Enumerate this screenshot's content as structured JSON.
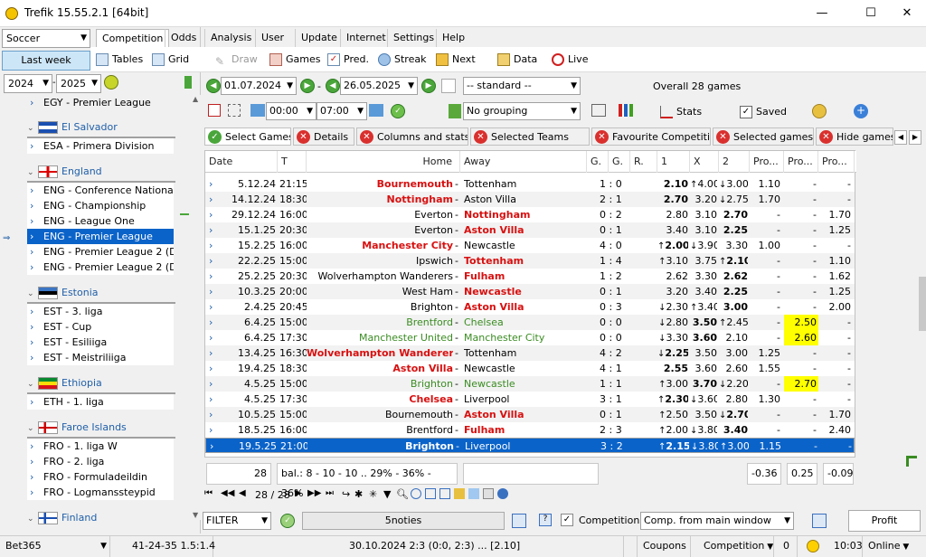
{
  "window": {
    "title": "Trefik 15.55.2.1 [64bit]",
    "minimize": "—",
    "maximize": "☐",
    "close": "✕"
  },
  "sport_select": "Soccer",
  "last_week_button": "Last week",
  "year_from": "2024",
  "year_to": "2025",
  "menu": [
    "Competition",
    "Odds",
    "Analysis",
    "User",
    "Update",
    "Internet",
    "Settings",
    "Help"
  ],
  "toolbar": {
    "tables": "Tables",
    "grid": "Grid",
    "draw": "Draw",
    "games": "Games",
    "pred": "Pred.",
    "streak": "Streak",
    "next": "Next",
    "data": "Data",
    "live": "Live"
  },
  "tree": {
    "top_league": "EGY - Premier League",
    "countries": [
      {
        "name": "El Salvador",
        "leagues": [
          "ESA - Primera Division"
        ]
      },
      {
        "name": "England",
        "leagues": [
          "ENG - Conference National",
          "ENG - Championship",
          "ENG - League One",
          "ENG - Premier League",
          "ENG - Premier League 2 (D...",
          "ENG - Premier League 2 (D..."
        ]
      },
      {
        "name": "Estonia",
        "leagues": [
          "EST - 3. liga",
          "EST - Cup",
          "EST - Esiliiga",
          "EST - Meistriliiga"
        ]
      },
      {
        "name": "Ethiopia",
        "leagues": [
          "ETH - 1. liga"
        ]
      },
      {
        "name": "Faroe Islands",
        "leagues": [
          "FRO - 1. liga W",
          "FRO - 2. liga",
          "FRO - Formuladeildin",
          "FRO - Logmanssteypid"
        ]
      },
      {
        "name": "Finland",
        "leagues": []
      }
    ]
  },
  "filters": {
    "date_from": "01.07.2024",
    "date_to": "26.05.2025",
    "standard": "-- standard --",
    "time_from": "00:00",
    "time_to": "07:00",
    "grouping": "No grouping",
    "overall": "Overall 28 games",
    "stats": "Stats",
    "saved": "Saved"
  },
  "subtabs": [
    "Select Games",
    "Details",
    "Columns and stats",
    "Selected Teams",
    "Favourite Competitions",
    "Selected games",
    "Hide games"
  ],
  "columns": [
    "Date",
    "T",
    "Home",
    "Away",
    "G.",
    "G.",
    "R.",
    "1",
    "X",
    "2",
    "Pro...",
    "Pro...",
    "Pro..."
  ],
  "rows": [
    {
      "date": "5.12.24",
      "time": "21:15",
      "home": "Bournemouth",
      "away": "Tottenham",
      "hs": "red",
      "as": "",
      "g1": "1 : 0",
      "o1": "2.10",
      "a1": "",
      "ox": "4.00",
      "ax": "up",
      "o2": "3.00",
      "a2": "down",
      "b1": "b",
      "bx": "",
      "b2": "",
      "p1": "1.10",
      "p2": "-",
      "p3": "-",
      "y2": false
    },
    {
      "date": "14.12.24",
      "time": "18:30",
      "home": "Nottingham",
      "away": "Aston Villa",
      "hs": "red",
      "as": "",
      "g1": "2 : 1",
      "o1": "2.70",
      "a1": "",
      "ox": "3.20",
      "ax": "",
      "o2": "2.75",
      "a2": "down",
      "b1": "b",
      "bx": "",
      "b2": "",
      "p1": "1.70",
      "p2": "-",
      "p3": "-",
      "y2": false
    },
    {
      "date": "29.12.24",
      "time": "16:00",
      "home": "Everton",
      "away": "Nottingham",
      "hs": "",
      "as": "red",
      "g1": "0 : 2",
      "o1": "2.80",
      "a1": "",
      "ox": "3.10",
      "ax": "",
      "o2": "2.70",
      "a2": "",
      "b1": "",
      "bx": "",
      "b2": "b",
      "p1": "-",
      "p2": "-",
      "p3": "1.70",
      "y2": false
    },
    {
      "date": "15.1.25",
      "time": "20:30",
      "home": "Everton",
      "away": "Aston Villa",
      "hs": "",
      "as": "red",
      "g1": "0 : 1",
      "o1": "3.40",
      "a1": "",
      "ox": "3.10",
      "ax": "",
      "o2": "2.25",
      "a2": "",
      "b1": "",
      "bx": "",
      "b2": "b",
      "p1": "-",
      "p2": "-",
      "p3": "1.25",
      "y2": false
    },
    {
      "date": "15.2.25",
      "time": "16:00",
      "home": "Manchester City",
      "away": "Newcastle",
      "hs": "red",
      "as": "",
      "g1": "4 : 0",
      "o1": "2.00",
      "a1": "up",
      "ox": "3.90",
      "ax": "down",
      "o2": "3.30",
      "a2": "",
      "b1": "b",
      "bx": "",
      "b2": "",
      "p1": "1.00",
      "p2": "-",
      "p3": "-",
      "y2": false
    },
    {
      "date": "22.2.25",
      "time": "15:00",
      "home": "Ipswich",
      "away": "Tottenham",
      "hs": "",
      "as": "red",
      "g1": "1 : 4",
      "o1": "3.10",
      "a1": "up",
      "ox": "3.75",
      "ax": "",
      "o2": "2.10",
      "a2": "up",
      "b1": "",
      "bx": "",
      "b2": "b",
      "p1": "-",
      "p2": "-",
      "p3": "1.10",
      "y2": false
    },
    {
      "date": "25.2.25",
      "time": "20:30",
      "home": "Wolverhampton Wanderers",
      "away": "Fulham",
      "hs": "",
      "as": "red",
      "g1": "1 : 2",
      "o1": "2.62",
      "a1": "",
      "ox": "3.30",
      "ax": "",
      "o2": "2.62",
      "a2": "",
      "b1": "",
      "bx": "",
      "b2": "b",
      "p1": "-",
      "p2": "-",
      "p3": "1.62",
      "y2": false
    },
    {
      "date": "10.3.25",
      "time": "20:00",
      "home": "West Ham",
      "away": "Newcastle",
      "hs": "",
      "as": "red",
      "g1": "0 : 1",
      "o1": "3.20",
      "a1": "",
      "ox": "3.40",
      "ax": "",
      "o2": "2.25",
      "a2": "",
      "b1": "",
      "bx": "",
      "b2": "b",
      "p1": "-",
      "p2": "-",
      "p3": "1.25",
      "y2": false
    },
    {
      "date": "2.4.25",
      "time": "20:45",
      "home": "Brighton",
      "away": "Aston Villa",
      "hs": "",
      "as": "red",
      "g1": "0 : 3",
      "o1": "2.30",
      "a1": "down",
      "ox": "3.40",
      "ax": "up",
      "o2": "3.00",
      "a2": "",
      "b1": "",
      "bx": "",
      "b2": "b",
      "p1": "-",
      "p2": "-",
      "p3": "2.00",
      "y2": false
    },
    {
      "date": "6.4.25",
      "time": "15:00",
      "home": "Brentford",
      "away": "Chelsea",
      "hs": "grn",
      "as": "grn",
      "g1": "0 : 0",
      "o1": "2.80",
      "a1": "down",
      "ox": "3.50",
      "ax": "",
      "o2": "2.45",
      "a2": "up",
      "b1": "",
      "bx": "b",
      "b2": "",
      "p1": "-",
      "p2": "2.50",
      "p3": "-",
      "y2": true
    },
    {
      "date": "6.4.25",
      "time": "17:30",
      "home": "Manchester United",
      "away": "Manchester City",
      "hs": "grn",
      "as": "grn",
      "g1": "0 : 0",
      "o1": "3.30",
      "a1": "down",
      "ox": "3.60",
      "ax": "",
      "o2": "2.10",
      "a2": "",
      "b1": "",
      "bx": "b",
      "b2": "",
      "p1": "-",
      "p2": "2.60",
      "p3": "-",
      "y2": true
    },
    {
      "date": "13.4.25",
      "time": "16:30",
      "home": "Wolverhampton Wanderers",
      "away": "Tottenham",
      "hs": "red",
      "as": "",
      "g1": "4 : 2",
      "o1": "2.25",
      "a1": "down",
      "ox": "3.50",
      "ax": "",
      "o2": "3.00",
      "a2": "",
      "b1": "b",
      "bx": "",
      "b2": "",
      "p1": "1.25",
      "p2": "-",
      "p3": "-",
      "y2": false
    },
    {
      "date": "19.4.25",
      "time": "18:30",
      "home": "Aston Villa",
      "away": "Newcastle",
      "hs": "red",
      "as": "",
      "g1": "4 : 1",
      "o1": "2.55",
      "a1": "",
      "ox": "3.60",
      "ax": "",
      "o2": "2.60",
      "a2": "",
      "b1": "b",
      "bx": "",
      "b2": "",
      "p1": "1.55",
      "p2": "-",
      "p3": "-",
      "y2": false
    },
    {
      "date": "4.5.25",
      "time": "15:00",
      "home": "Brighton",
      "away": "Newcastle",
      "hs": "grn",
      "as": "grn",
      "g1": "1 : 1",
      "o1": "3.00",
      "a1": "up",
      "ox": "3.70",
      "ax": "",
      "o2": "2.20",
      "a2": "down",
      "b1": "",
      "bx": "b",
      "b2": "",
      "p1": "-",
      "p2": "2.70",
      "p3": "-",
      "y2": true
    },
    {
      "date": "4.5.25",
      "time": "17:30",
      "home": "Chelsea",
      "away": "Liverpool",
      "hs": "red",
      "as": "",
      "g1": "3 : 1",
      "o1": "2.30",
      "a1": "up",
      "ox": "3.60",
      "ax": "down",
      "o2": "2.80",
      "a2": "",
      "b1": "b",
      "bx": "",
      "b2": "",
      "p1": "1.30",
      "p2": "-",
      "p3": "-",
      "y2": false
    },
    {
      "date": "10.5.25",
      "time": "15:00",
      "home": "Bournemouth",
      "away": "Aston Villa",
      "hs": "",
      "as": "red",
      "g1": "0 : 1",
      "o1": "2.50",
      "a1": "up",
      "ox": "3.50",
      "ax": "",
      "o2": "2.70",
      "a2": "down",
      "b1": "",
      "bx": "",
      "b2": "b",
      "p1": "-",
      "p2": "-",
      "p3": "1.70",
      "y2": false
    },
    {
      "date": "18.5.25",
      "time": "16:00",
      "home": "Brentford",
      "away": "Fulham",
      "hs": "",
      "as": "red",
      "g1": "2 : 3",
      "o1": "2.00",
      "a1": "up",
      "ox": "3.80",
      "ax": "down",
      "o2": "3.40",
      "a2": "",
      "b1": "",
      "bx": "",
      "b2": "b",
      "p1": "-",
      "p2": "-",
      "p3": "2.40",
      "y2": false
    },
    {
      "date": "19.5.25",
      "time": "21:00",
      "home": "Brighton",
      "away": "Liverpool",
      "hs": "sel",
      "as": "sel",
      "g1": "3 : 2",
      "o1": "2.15",
      "a1": "up",
      "ox": "3.80",
      "ax": "down",
      "o2": "3.00",
      "a2": "up",
      "b1": "b",
      "bx": "",
      "b2": "",
      "p1": "1.15",
      "p2": "-",
      "p3": "-",
      "y2": false
    }
  ],
  "summary": {
    "count": "28",
    "bal": "bal.: 8 - 10 - 10 .. 29% - 36% - 36%",
    "s1": "-0.36",
    "s2": "0.25",
    "s3": "-0.09"
  },
  "nav": {
    "page": "28 / 28"
  },
  "filterbar": {
    "filter": "FILTER",
    "notes": "5noties",
    "competitions": "Competitions",
    "comp_from": "Comp. from main window",
    "profit": "Profit"
  },
  "status": {
    "bookmaker": "Bet365",
    "record": "41-24-35",
    "ratio": "1.5:1.4",
    "match": "30.10.2024 2:3 (0:0, 2:3) ... [2.10]",
    "coupons": "Coupons",
    "competition": "Competition",
    "count": "0",
    "time": "10:03",
    "online": "Online"
  }
}
